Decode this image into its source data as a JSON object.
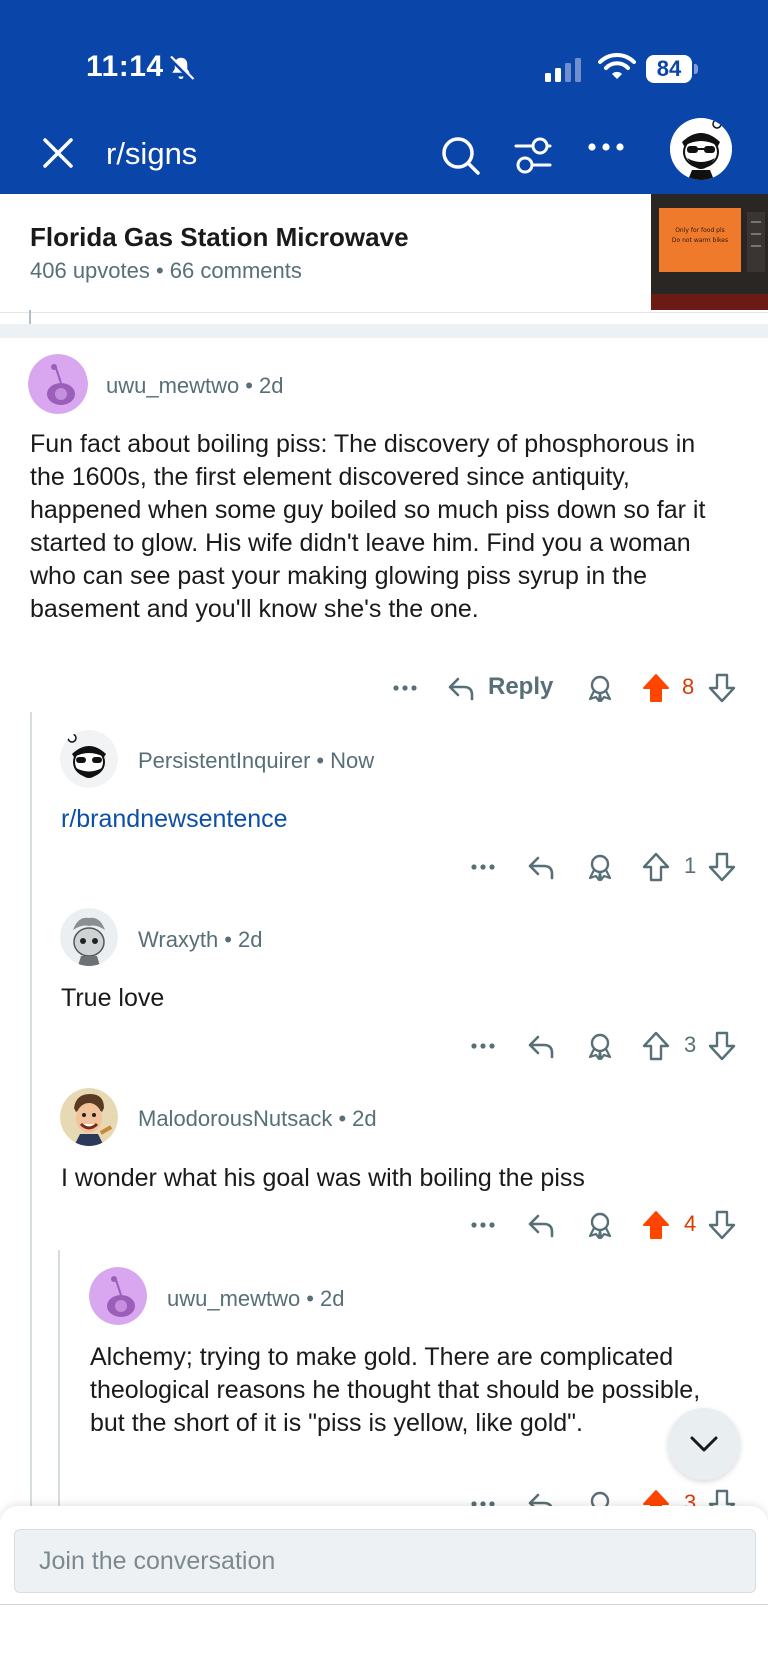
{
  "status_bar": {
    "time": "11:14",
    "battery": "84"
  },
  "toolbar": {
    "subreddit": "r/signs"
  },
  "post": {
    "title": "Florida Gas Station Microwave",
    "meta": "406 upvotes • 66 comments",
    "thumb_lines": [
      "Only for food pls",
      "Do not warm bikes"
    ]
  },
  "comments": [
    {
      "author": "uwu_mewtwo",
      "age": "2d",
      "body": "Fun fact about boiling piss: The discovery of phosphorous in the 1600s, the first element discovered since antiquity, happened when some guy boiled so much piss down so far it started to glow. His wife didn't leave him. Find you a woman who can see past your making glowing piss syrup in the basement and you'll know she's the one.",
      "reply_label": "Reply",
      "votes": "8",
      "upvoted": true
    },
    {
      "author": "PersistentInquirer",
      "age": "Now",
      "body": "r/brandnewsentence",
      "votes": "1",
      "upvoted": false
    },
    {
      "author": "Wraxyth",
      "age": "2d",
      "body": "True love",
      "votes": "3",
      "upvoted": false
    },
    {
      "author": "MalodorousNutsack",
      "age": "2d",
      "body": "I wonder what his goal was with boiling the piss",
      "votes": "4",
      "upvoted": true
    },
    {
      "author": "uwu_mewtwo",
      "age": "2d",
      "body": "Alchemy; trying to make gold. There are complicated theological reasons he thought that should be possible, but the short of it is \"piss is yellow, like gold\".",
      "votes": "3",
      "upvoted": true
    }
  ],
  "composer": {
    "placeholder": "Join the conversation"
  },
  "colors": {
    "header": "#0a45a9",
    "upvote": "#ff4500",
    "link": "#0b4fa8"
  },
  "icons": [
    "bell-off-icon",
    "signal-icon",
    "wifi-icon",
    "close-icon",
    "search-icon",
    "filter-icon",
    "more-icon",
    "reply-icon",
    "award-icon",
    "upvote-icon",
    "downvote-icon",
    "chevron-down-icon"
  ]
}
